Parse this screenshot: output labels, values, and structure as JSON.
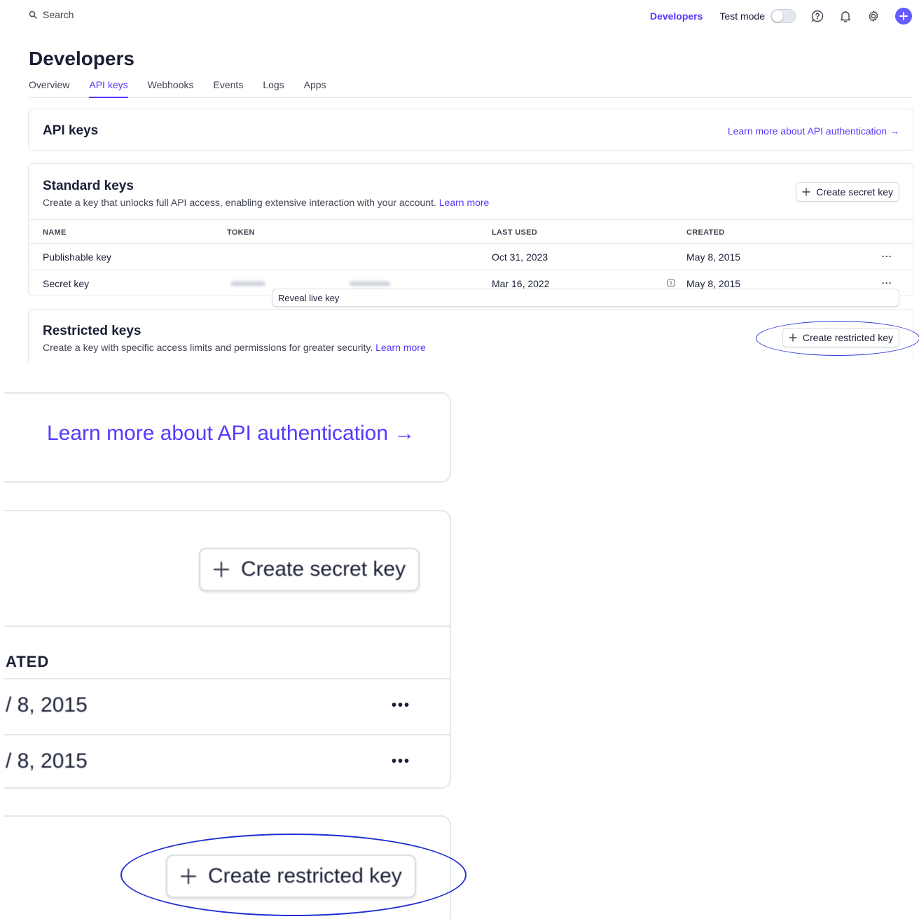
{
  "topbar": {
    "search_label": "Search",
    "developers_link": "Developers",
    "test_mode_label": "Test mode",
    "test_mode_on": false,
    "accent_color": "#533afd"
  },
  "header": {
    "title": "Developers",
    "tabs": [
      {
        "label": "Overview",
        "active": false
      },
      {
        "label": "API keys",
        "active": true
      },
      {
        "label": "Webhooks",
        "active": false
      },
      {
        "label": "Events",
        "active": false
      },
      {
        "label": "Logs",
        "active": false
      },
      {
        "label": "Apps",
        "active": false
      }
    ]
  },
  "api_keys_card": {
    "title": "API keys",
    "learn_link": "Learn more about API authentication →"
  },
  "standard_keys": {
    "title": "Standard keys",
    "description": "Create a key that unlocks full API access, enabling extensive interaction with your account.",
    "learn_more": "Learn more",
    "create_button": "Create secret key",
    "columns": [
      "NAME",
      "TOKEN",
      "LAST USED",
      "CREATED"
    ],
    "rows": [
      {
        "name": "Publishable key",
        "token": "",
        "last_used": "Oct 31, 2023",
        "created": "May 8, 2015",
        "more": "···"
      },
      {
        "name": "Secret key",
        "token_button": "Reveal live key",
        "last_used": "Mar 16, 2022",
        "created": "May 8, 2015",
        "more": "···"
      }
    ]
  },
  "restricted_keys": {
    "title": "Restricted keys",
    "description": "Create a key with specific access limits and permissions for greater security.",
    "learn_more": "Learn more",
    "create_button": "Create restricted key"
  },
  "zoom_inset": {
    "learn_link": "Learn more about API authentication →",
    "create_secret": "Create secret key",
    "created_header_partial": "ATED",
    "date_1": "/ 8, 2015",
    "date_2": "/ 8, 2015",
    "more_1": "•••",
    "more_2": "•••",
    "create_restricted": "Create restricted key",
    "highlight_color": "#1f2fd0"
  }
}
